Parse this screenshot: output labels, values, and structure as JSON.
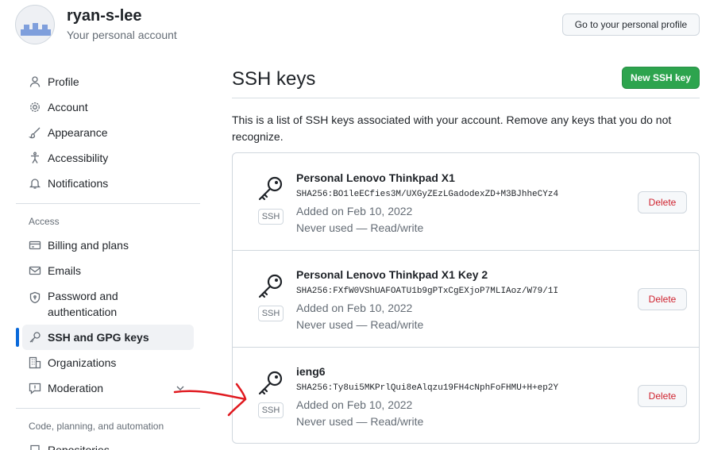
{
  "account": {
    "username": "ryan-s-lee",
    "subtitle": "Your personal account",
    "profile_button": "Go to your personal profile"
  },
  "sidebar": {
    "items": [
      {
        "label": "Profile",
        "icon": "person-icon"
      },
      {
        "label": "Account",
        "icon": "gear-icon"
      },
      {
        "label": "Appearance",
        "icon": "paintbrush-icon"
      },
      {
        "label": "Accessibility",
        "icon": "accessibility-icon"
      },
      {
        "label": "Notifications",
        "icon": "bell-icon"
      }
    ],
    "access_label": "Access",
    "access_items": [
      {
        "label": "Billing and plans",
        "icon": "credit-card-icon"
      },
      {
        "label": "Emails",
        "icon": "mail-icon"
      },
      {
        "label": "Password and authentication",
        "icon": "shield-lock-icon"
      },
      {
        "label": "SSH and GPG keys",
        "icon": "key-icon",
        "active": true
      },
      {
        "label": "Organizations",
        "icon": "organization-icon"
      },
      {
        "label": "Moderation",
        "icon": "report-icon"
      }
    ],
    "code_label": "Code, planning, and automation",
    "code_items": [
      {
        "label": "Repositories",
        "icon": "repo-icon"
      }
    ]
  },
  "main": {
    "title": "SSH keys",
    "new_button": "New SSH key",
    "intro": "This is a list of SSH keys associated with your account. Remove any keys that you do not recognize.",
    "keys": [
      {
        "title": "Personal Lenovo Thinkpad X1",
        "fingerprint": "SHA256:BO1leECfies3M/UXGyZEzLGadodexZD+M3BJhheCYz4",
        "added": "Added on Feb 10, 2022",
        "usage": "Never used — Read/write",
        "badge": "SSH",
        "delete_label": "Delete"
      },
      {
        "title": "Personal Lenovo Thinkpad X1 Key 2",
        "fingerprint": "SHA256:FXfW0VShUAFOATU1b9gPTxCgEXjoP7MLIAoz/W79/1I",
        "added": "Added on Feb 10, 2022",
        "usage": "Never used — Read/write",
        "badge": "SSH",
        "delete_label": "Delete"
      },
      {
        "title": "ieng6",
        "fingerprint": "SHA256:Ty8ui5MKPrlQui8eAlqzu19FH4cNphFoFHMU+H+ep2Y",
        "added": "Added on Feb 10, 2022",
        "usage": "Never used — Read/write",
        "badge": "SSH",
        "delete_label": "Delete"
      }
    ]
  },
  "colors": {
    "accent": "#0969da",
    "primary_button": "#2da44e",
    "danger": "#cf222e",
    "annotation": "#e0191f"
  }
}
